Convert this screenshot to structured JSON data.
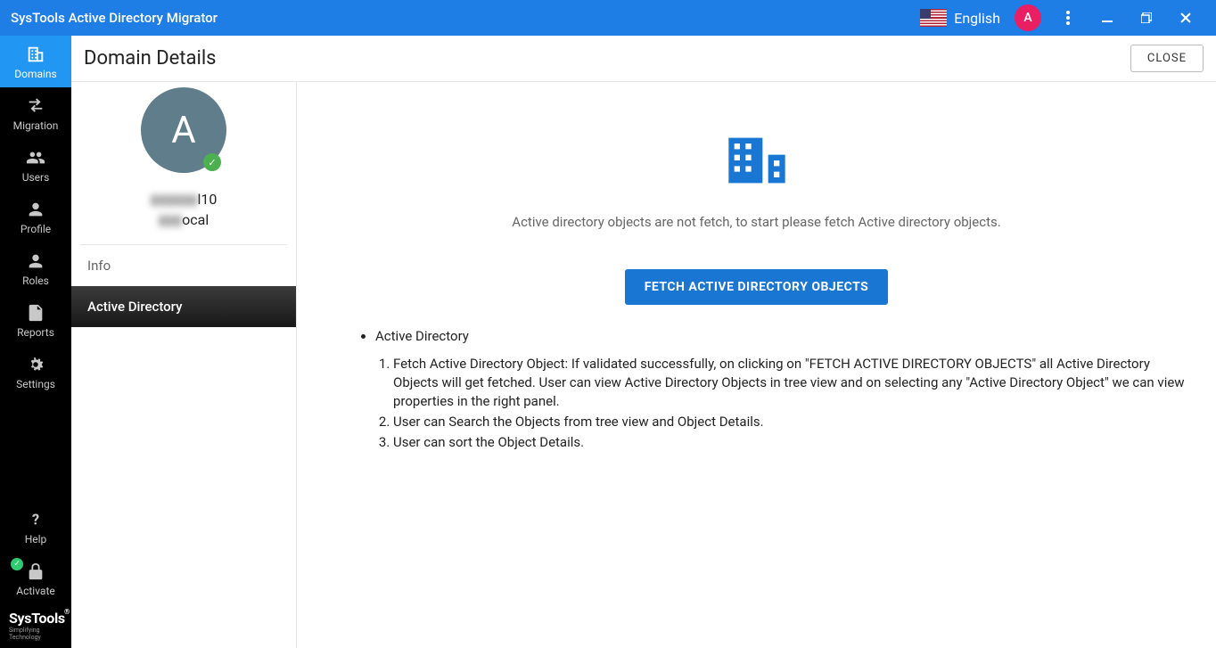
{
  "titlebar": {
    "title": "SysTools Active Directory Migrator",
    "language": "English",
    "avatar_letter": "A"
  },
  "sidebar": {
    "items": [
      {
        "label": "Domains"
      },
      {
        "label": "Migration"
      },
      {
        "label": "Users"
      },
      {
        "label": "Profile"
      },
      {
        "label": "Roles"
      },
      {
        "label": "Reports"
      },
      {
        "label": "Settings"
      }
    ],
    "help_label": "Help",
    "activate_label": "Activate",
    "brand_main": "SysTools",
    "brand_sub": "Simplifying Technology"
  },
  "page": {
    "title": "Domain Details",
    "close_label": "CLOSE"
  },
  "domain_panel": {
    "avatar_letter": "A",
    "name_hidden": "▮▮▮▮▮▮",
    "name_suffix": "l10",
    "sub_hidden": "▮▮▮",
    "sub_suffix": "ocal",
    "tabs": [
      {
        "label": "Info"
      },
      {
        "label": "Active Directory"
      }
    ]
  },
  "main": {
    "empty_message": "Active directory objects are not fetch, to start please fetch Active directory objects.",
    "fetch_button": "FETCH ACTIVE DIRECTORY OBJECTS",
    "help_heading": "Active Directory",
    "help_items": [
      "Fetch Active Directory Object: If validated successfully, on clicking on \"FETCH ACTIVE DIRECTORY OBJECTS\" all Active Directory Objects will get fetched. User can view Active Directory Objects in tree view and on selecting any \"Active Directory Object\" we can view properties in the right panel.",
      "User can Search the Objects from tree view and Object Details.",
      "User can sort the Object Details."
    ]
  }
}
